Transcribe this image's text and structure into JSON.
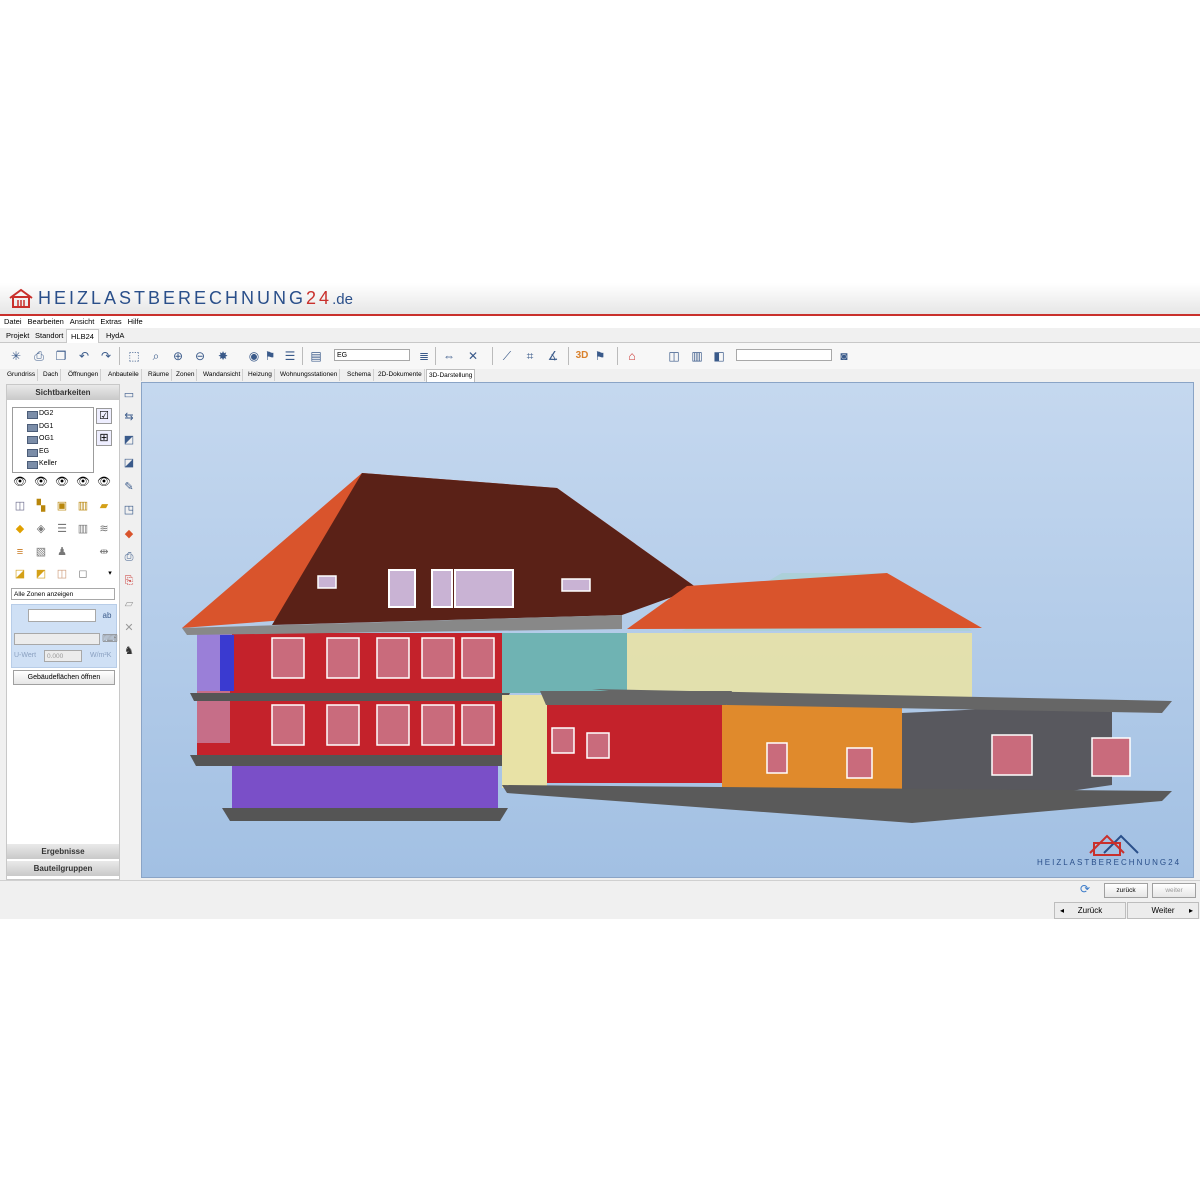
{
  "app": {
    "brand_name": "HEIZLASTBERECHNUNG",
    "brand_number": "24",
    "brand_tld": ".de"
  },
  "menu": [
    "Datei",
    "Bearbeiten",
    "Ansicht",
    "Extras",
    "Hilfe"
  ],
  "ribbon_tabs": [
    {
      "label": "Projekt",
      "active": false
    },
    {
      "label": "Standort",
      "active": false
    },
    {
      "label": "HLB24",
      "active": true
    },
    {
      "label": "HydA",
      "active": false
    }
  ],
  "toolbar": {
    "floor_combo_value": "EG",
    "search_value": "",
    "view3d_label": "3D"
  },
  "sub_tabs": [
    {
      "label": "Grundriss",
      "active": false
    },
    {
      "label": "Dach",
      "active": false
    },
    {
      "label": "Öffnungen",
      "active": false
    },
    {
      "label": "Anbauteile",
      "active": false
    },
    {
      "label": "Räume",
      "active": false
    },
    {
      "label": "Zonen",
      "active": false
    },
    {
      "label": "Wandansicht",
      "active": false
    },
    {
      "label": "Heizung",
      "active": false
    },
    {
      "label": "Wohnungsstationen",
      "active": false
    },
    {
      "label": "Schema",
      "active": false
    },
    {
      "label": "2D-Dokumente",
      "active": false
    },
    {
      "label": "3D-Darstellung",
      "active": true
    }
  ],
  "left_panel": {
    "header": "Sichtbarkeiten",
    "floors": [
      "DG2",
      "DG1",
      "OG1",
      "EG",
      "Keller"
    ],
    "zone_select": "Alle Zonen anzeigen",
    "uwert_label": "U-Wert",
    "uwert_value": "0.000",
    "uwert_unit": "W/m²K",
    "open_button": "Gebäudeflächen öffnen",
    "footer_results": "Ergebnisse",
    "footer_groups": "Bauteilgruppen"
  },
  "viewport": {
    "watermark": "HEIZLASTBERECHNUNG24",
    "colors": {
      "roof_dark": "#5a2117",
      "roof_tiles": "#d9542c",
      "zone_red": "#c4222b",
      "zone_violet": "#7a4fc8",
      "zone_teal": "#6fb3b3",
      "zone_yellow": "#e8e2a6",
      "zone_orange": "#e08a2c",
      "zone_gray": "#58585e"
    }
  },
  "status": {
    "back_small": "zurück",
    "next_small": "weiter"
  },
  "nav": {
    "back": "Zurück",
    "next": "Weiter"
  }
}
